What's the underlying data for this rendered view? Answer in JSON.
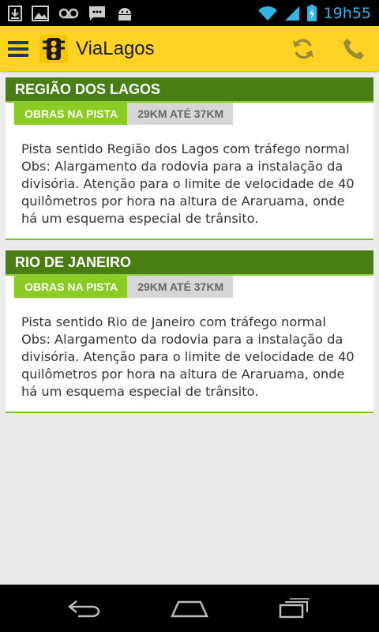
{
  "status_bar": {
    "time": "19h55",
    "icons": [
      "download-icon",
      "image-icon",
      "voicemail-icon",
      "sms-icon",
      "android-icon",
      "wifi-icon",
      "signal-icon",
      "battery-charging-icon"
    ]
  },
  "app_bar": {
    "title": "ViaLagos",
    "brand_color": "#ffd324",
    "icons": [
      "menu-icon",
      "traffic-light-logo-icon",
      "refresh-icon",
      "phone-icon"
    ]
  },
  "cards": [
    {
      "header": "REGIÃO DOS LAGOS",
      "status": "OBRAS NA PISTA",
      "range": "29KM ATÉ 37KM",
      "text": "Pista sentido Região dos Lagos com tráfego normal\nObs: Alargamento da rodovia para a instalação da divisória. Atenção para o limite de velocidade de 40 quilômetros por hora na altura de Araruama, onde há um esquema especial de trânsito."
    },
    {
      "header": "RIO DE JANEIRO",
      "status": "OBRAS NA PISTA",
      "range": "29KM ATÉ 37KM",
      "text": "Pista sentido Rio de Janeiro com tráfego normal Obs: Alargamento da rodovia  para a instalação da divisória. Atenção para o limite de velocidade de 40 quilômetros por hora na altura de Araruama, onde há um esquema especial de trânsito."
    }
  ],
  "colors": {
    "header_green": "#4a7d12",
    "tag_green": "#8ccb24",
    "tag_grey": "#d6d6d6",
    "accent_blue": "#33b5e5"
  },
  "nav_bar": {
    "icons": [
      "back-icon",
      "home-icon",
      "recent-apps-icon"
    ]
  }
}
